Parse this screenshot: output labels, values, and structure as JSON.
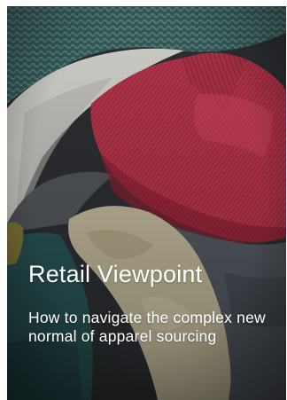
{
  "card": {
    "title": "Retail Viewpoint",
    "description": "How to navigate the complex new normal of apparel sourcing",
    "image": "folded-clothes-pile-photo"
  },
  "colors": {
    "knit_teal": "#4e7f7c",
    "red_sweater": "#c23a52",
    "white_shirt": "#dcdcd6",
    "cream_knit": "#c9c0a0",
    "gray_denim": "#5b6168",
    "teal_fabric": "#2d5a5c",
    "text": "#ffffff"
  }
}
